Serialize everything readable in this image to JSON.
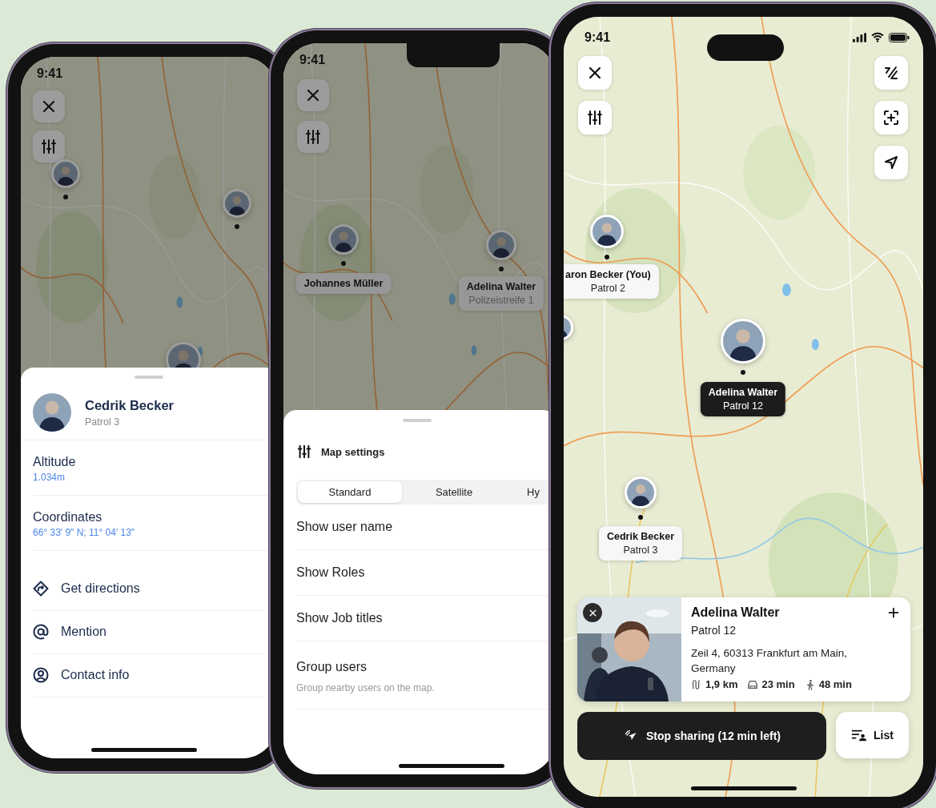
{
  "phones": [
    {
      "kind": "contact",
      "time": "9:41",
      "dimmed": true,
      "sheet": {
        "name": "Cedrik Becker",
        "subtitle": "Patrol 3",
        "fields": [
          {
            "label": "Altitude",
            "value": "1.034m"
          },
          {
            "label": "Coordinates",
            "value": "66° 33′ 9″ N; 11° 04′ 13″"
          }
        ],
        "actions": [
          {
            "label": "Get directions"
          },
          {
            "label": "Mention"
          },
          {
            "label": "Contact info"
          }
        ]
      }
    },
    {
      "kind": "settings",
      "time": "9:41",
      "dimmed": true,
      "markers": [
        {
          "name": "Johannes Müller",
          "selected": false
        },
        {
          "name": "Adelina Walter",
          "subtitle": "Polizeistreife 1",
          "selected": false
        }
      ],
      "sheet": {
        "title": "Map settings",
        "tabs": [
          {
            "label": "Standard",
            "selected": true
          },
          {
            "label": "Satellite",
            "selected": false
          },
          {
            "label": "Hy",
            "selected": false
          }
        ],
        "rows": [
          {
            "label": "Show user name"
          },
          {
            "label": "Show Roles"
          },
          {
            "label": "Show Job titles"
          },
          {
            "label": "Group users",
            "description": "Group nearby users on the map."
          }
        ]
      }
    },
    {
      "kind": "live",
      "time": "9:41",
      "dimmed": false,
      "markers": [
        {
          "name": "aron Becker (You)",
          "subtitle": "Patrol 2",
          "selected": false
        },
        {
          "name": "Adelina Walter",
          "subtitle": "Patrol 12",
          "selected": true
        },
        {
          "name": "Cedrik Becker",
          "subtitle": "Patrol 3",
          "selected": false
        }
      ],
      "card": {
        "name": "Adelina Walter",
        "subtitle": "Patrol 12",
        "address": "Zeil 4, 60313 Frankfurt am Main, Germany",
        "stats": [
          {
            "value": "1,9 km"
          },
          {
            "value": "23 min"
          },
          {
            "value": "48 min"
          }
        ]
      },
      "share_button": "Stop sharing (12 min left)",
      "list_button": "List"
    }
  ]
}
